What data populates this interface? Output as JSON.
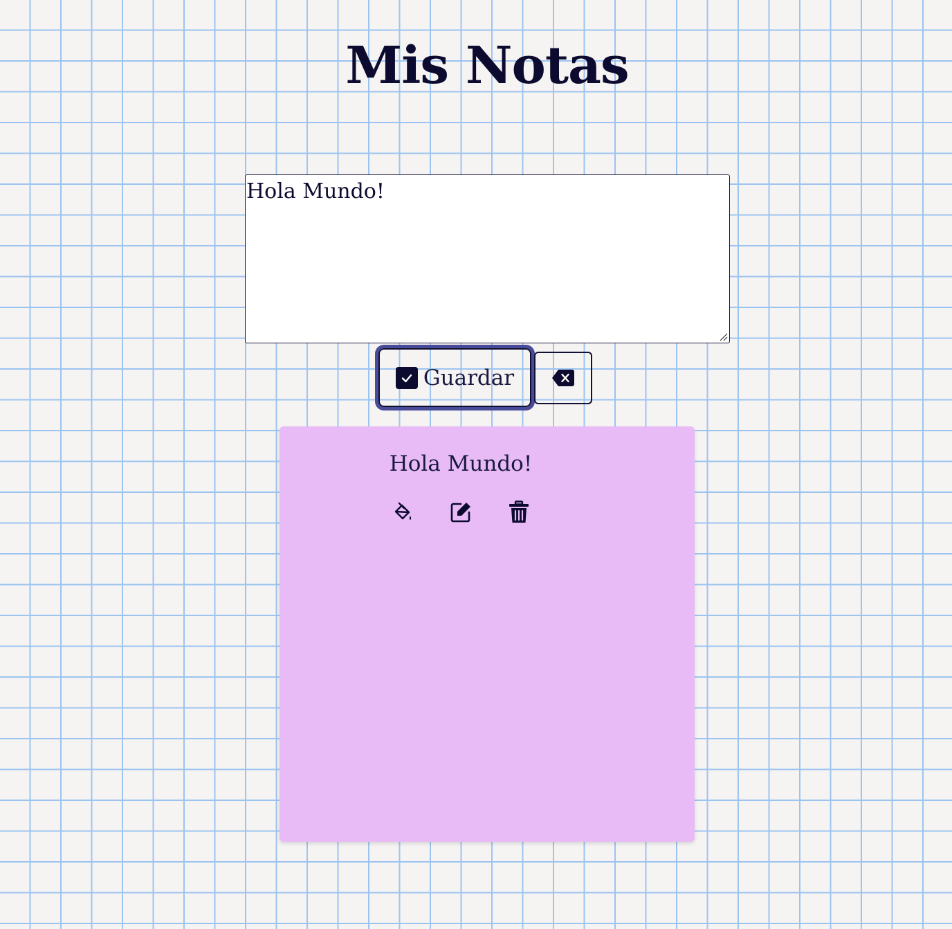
{
  "page": {
    "title": "Mis Notas"
  },
  "editor": {
    "value": "Hola Mundo!",
    "save_label": "Guardar",
    "save_icon": "check-square-icon",
    "clear_icon": "backspace-icon"
  },
  "notes": [
    {
      "text": "Hola Mundo!",
      "color": "#e8bbf7",
      "actions": [
        "paint-bucket-icon",
        "edit-icon",
        "trash-icon"
      ]
    }
  ],
  "colors": {
    "grid_line": "#9cc4f0",
    "background": "#f6f3f3",
    "text": "#0c0a2e",
    "focus_ring": "#4a4b98"
  }
}
